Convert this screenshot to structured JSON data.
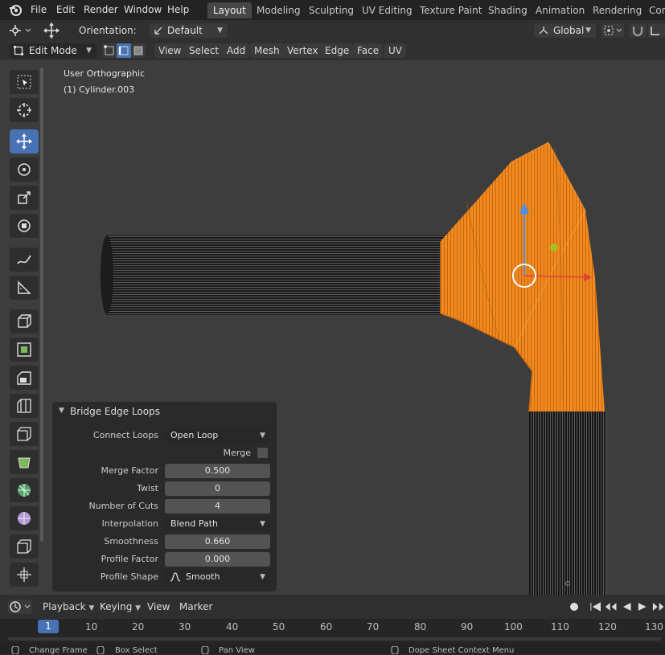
{
  "menu": {
    "items": [
      "File",
      "Edit",
      "Render",
      "Window",
      "Help"
    ]
  },
  "workspaces": {
    "tabs": [
      "Layout",
      "Modeling",
      "Sculpting",
      "UV Editing",
      "Texture Paint",
      "Shading",
      "Animation",
      "Rendering",
      "Con"
    ],
    "active": "Layout"
  },
  "header1": {
    "orientation_label": "Orientation:",
    "orientation_value": "Default",
    "transform_space": "Global"
  },
  "header2": {
    "mode": "Edit Mode",
    "menus": [
      "View",
      "Select",
      "Add",
      "Mesh",
      "Vertex",
      "Edge",
      "Face",
      "UV"
    ]
  },
  "viewport": {
    "view_name": "User Orthographic",
    "object_name": "(1) Cylinder.003"
  },
  "operator_panel": {
    "title": "Bridge Edge Loops",
    "fields": [
      {
        "label": "Connect Loops",
        "value": "Open Loop",
        "kind": "dropdown"
      },
      {
        "label": "Merge",
        "value": "",
        "kind": "checkbox"
      },
      {
        "label": "Merge Factor",
        "value": "0.500",
        "kind": "number"
      },
      {
        "label": "Twist",
        "value": "0",
        "kind": "number"
      },
      {
        "label": "Number of Cuts",
        "value": "4",
        "kind": "number"
      },
      {
        "label": "Interpolation",
        "value": "Blend Path",
        "kind": "dropdown"
      },
      {
        "label": "Smoothness",
        "value": "0.660",
        "kind": "number"
      },
      {
        "label": "Profile Factor",
        "value": "0.000",
        "kind": "number"
      },
      {
        "label": "Profile Shape",
        "value": "Smooth",
        "kind": "dropdown"
      }
    ]
  },
  "timeline": {
    "menus": [
      "Playback",
      "Keying",
      "View",
      "Marker"
    ],
    "current_frame": "1",
    "frames": [
      "10",
      "20",
      "30",
      "40",
      "50",
      "60",
      "70",
      "80",
      "90",
      "100",
      "110",
      "120",
      "130"
    ]
  },
  "statusbar": {
    "items": [
      "Change Frame",
      "Box Select",
      "Pan View",
      "Dope Sheet Context Menu"
    ]
  },
  "colors": {
    "accent": "#4772b3",
    "selection_orange": "#f08a1e",
    "viewport_bg": "#3d3d3d"
  }
}
